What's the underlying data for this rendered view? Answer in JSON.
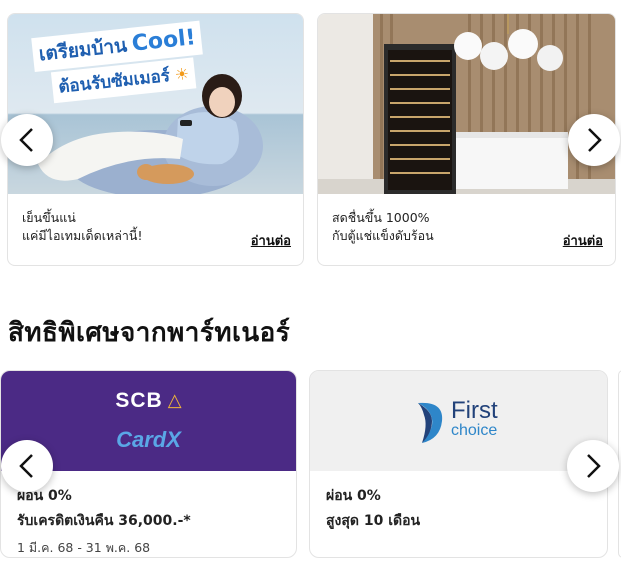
{
  "articles": [
    {
      "banner_line1": "เตรียมบ้าน",
      "banner_word": "Cool!",
      "banner_line2": "ต้อนรับซัมเมอร์",
      "text_line1": "เย็นขึ้นแน่",
      "text_line2": "แค่มีไอเทมเด็ดเหล่านี้!",
      "read_more": "อ่านต่อ"
    },
    {
      "text_line1": "สดชื่นขึ้น 1000%",
      "text_line2": "กับตู้แช่แข็งดับร้อน",
      "read_more": "อ่านต่อ"
    }
  ],
  "partners_section": {
    "title": "สิทธิพิเศษจากพาร์ทเนอร์",
    "cards": [
      {
        "logo_top": "SCB",
        "logo_bottom": "CardX",
        "line1": "ผ่อน 0%",
        "line2": "รับเครดิตเงินคืน 36,000.-*",
        "line3": "1 มี.ค. 68 - 31 พ.ค. 68"
      },
      {
        "logo_top": "First",
        "logo_bottom": "choice",
        "line1": "ผ่อน 0%",
        "line2": "สูงสุด 10 เดือน"
      }
    ]
  },
  "colors": {
    "scb_purple": "#4b2a85",
    "cardx_blue": "#5aa7e6",
    "firstchoice_navy": "#22427a",
    "firstchoice_blue": "#2e86c9"
  },
  "icons": {
    "prev": "chevron-left-icon",
    "next": "chevron-right-icon"
  }
}
